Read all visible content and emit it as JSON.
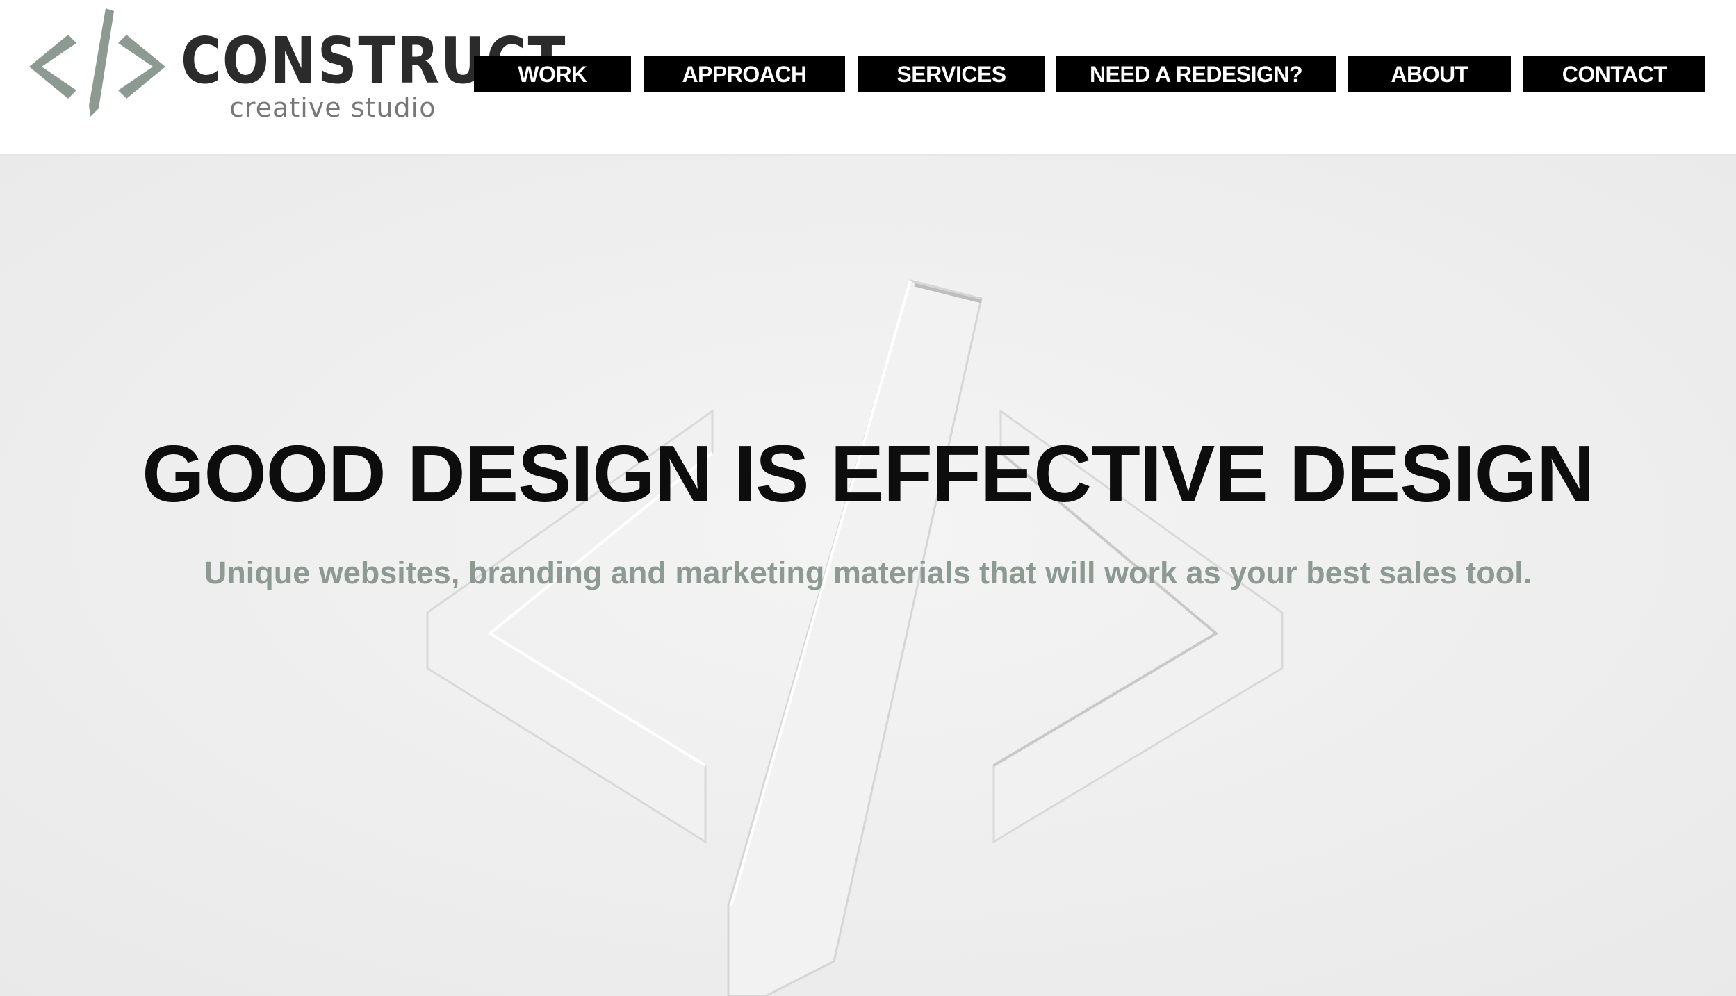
{
  "brand": {
    "name": "CONSTRUCT",
    "tagline": "creative studio",
    "accent_color": "#8c9a92"
  },
  "nav": {
    "items": [
      {
        "label": "WORK"
      },
      {
        "label": "APPROACH"
      },
      {
        "label": "SERVICES"
      },
      {
        "label": "NEED A REDESIGN?"
      },
      {
        "label": "ABOUT"
      },
      {
        "label": "CONTACT"
      }
    ]
  },
  "hero": {
    "title": "GOOD DESIGN IS EFFECTIVE DESIGN",
    "subtitle": "Unique websites, branding and marketing materials that will work as your best sales tool.",
    "background_icon": "embossed-code-pencil-icon"
  }
}
